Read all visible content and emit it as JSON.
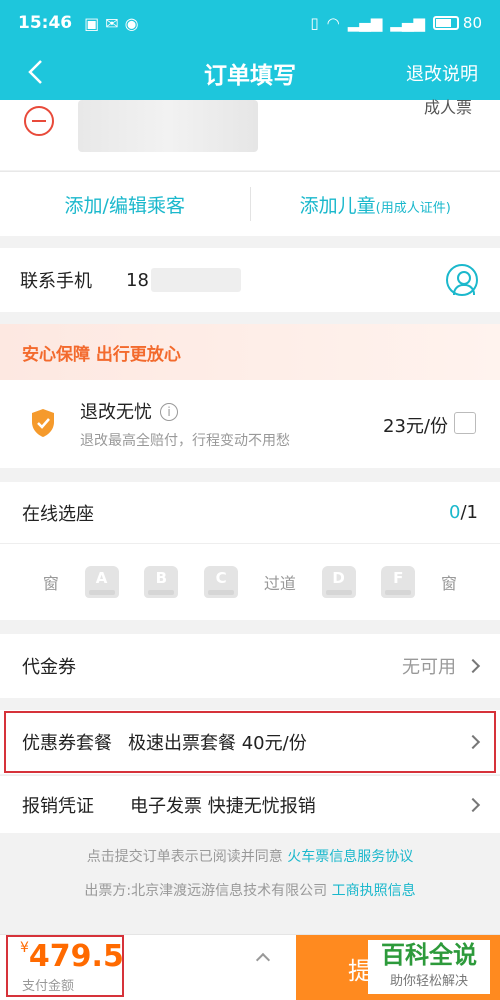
{
  "status": {
    "time": "15:46",
    "battery": "80"
  },
  "header": {
    "title": "订单填写",
    "right": "退改说明"
  },
  "passenger": {
    "ticket_type": "成人票"
  },
  "actions": {
    "add_edit": "添加/编辑乘客",
    "add_child": "添加儿童",
    "add_child_note": "(用成人证件)"
  },
  "contact": {
    "label": "联系手机",
    "value": "18"
  },
  "insurance": {
    "banner": "安心保障 出行更放心",
    "title": "退改无忧",
    "subtitle": "退改最高全赔付，行程变动不用愁",
    "price": "23元/份"
  },
  "seat": {
    "title": "在线选座",
    "selected": "0",
    "total": "/1",
    "window_left": "窗",
    "aisle": "过道",
    "window_right": "窗",
    "seats": [
      "A",
      "B",
      "C",
      "D",
      "F"
    ]
  },
  "voucher": {
    "label": "代金券",
    "value": "无可用"
  },
  "coupon": {
    "label": "优惠券套餐",
    "value": "极速出票套餐  40元/份"
  },
  "receipt": {
    "label": "报销凭证",
    "value": "电子发票 快捷无忧报销"
  },
  "notice": {
    "line1_text": "点击提交订单表示已阅读并同意",
    "line1_link": "火车票信息服务协议",
    "line2_text": "出票方:北京津渡远游信息技术有限公司",
    "line2_link": "工商执照信息"
  },
  "bottom": {
    "currency": "¥",
    "amount": "479.5",
    "amount_label": "支付金额",
    "submit": "提"
  },
  "watermark": {
    "title": "百科全说",
    "subtitle": "助你轻松解决"
  },
  "colors": {
    "brand": "#1ec6dc",
    "accent": "#1bb8cc",
    "orange": "#ff8a1f",
    "highlight": "#d6323a"
  }
}
